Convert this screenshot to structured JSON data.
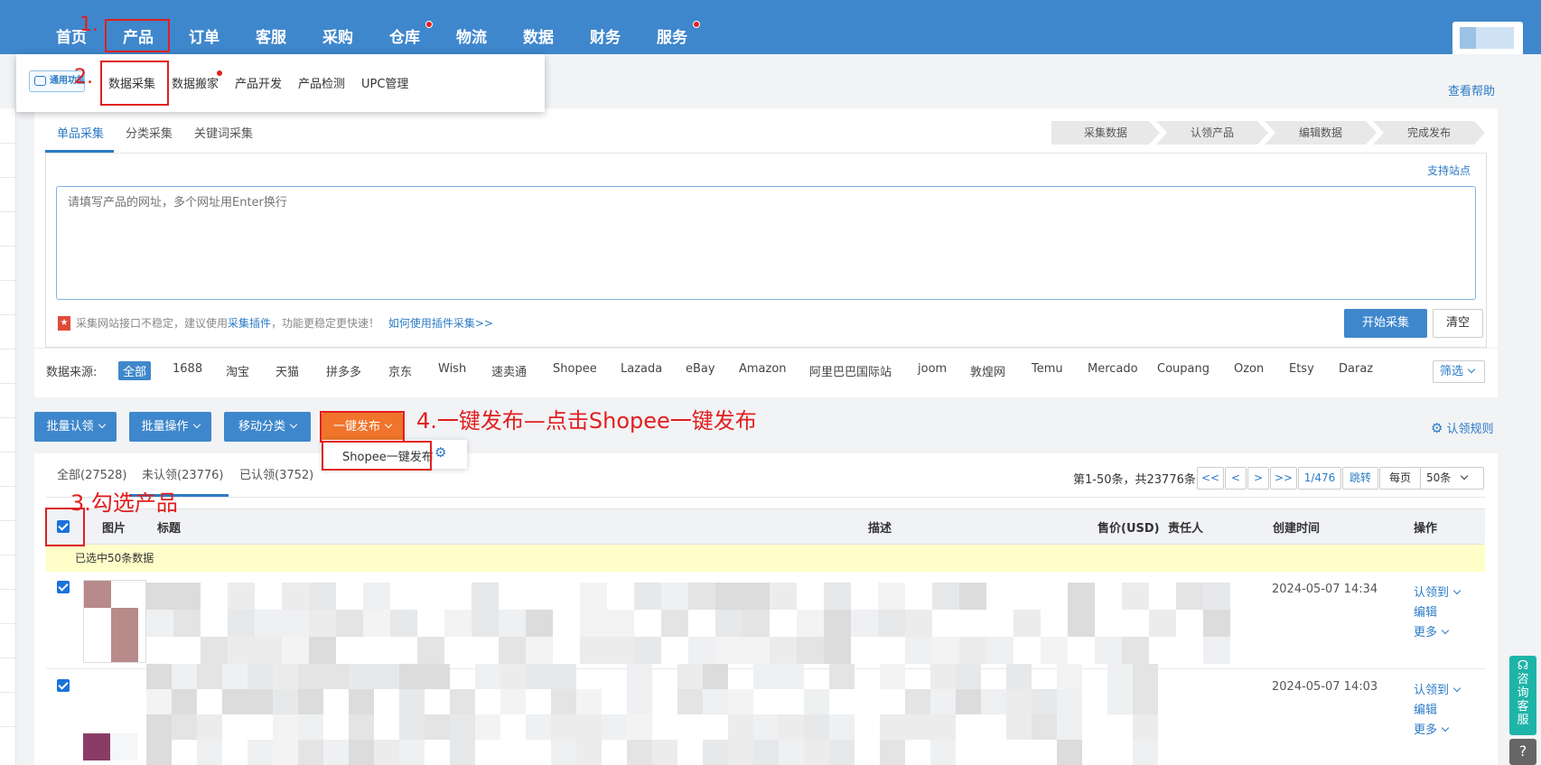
{
  "top_nav": {
    "items": [
      "首页",
      "产品",
      "订单",
      "客服",
      "采购",
      "仓库",
      "物流",
      "数据",
      "财务",
      "服务"
    ]
  },
  "sub_menu": {
    "badge": "通用功能",
    "items": [
      "数据采集",
      "数据搬家",
      "产品开发",
      "产品检测",
      "UPC管理"
    ]
  },
  "help_link": "查看帮助",
  "collect_tabs": [
    "单品采集",
    "分类采集",
    "关键词采集"
  ],
  "steps": [
    "采集数据",
    "认领产品",
    "编辑数据",
    "完成发布"
  ],
  "support_sites": "支持站点",
  "url_input": {
    "placeholder": "请填写产品的网址，多个网址用Enter换行"
  },
  "notice": {
    "text1": "采集网站接口不稳定，建议使用",
    "plugin_link": "采集插件",
    "text2": "，功能更稳定更快速！",
    "howto_link": "如何使用插件采集>>"
  },
  "start_button": "开始采集",
  "clear_button": "清空",
  "source": {
    "label": "数据来源:",
    "items": [
      "全部",
      "1688",
      "淘宝",
      "天猫",
      "拼多多",
      "京东",
      "Wish",
      "速卖通",
      "Shopee",
      "Lazada",
      "eBay",
      "Amazon",
      "阿里巴巴国际站",
      "joom",
      "敦煌网",
      "Temu",
      "Mercado",
      "Coupang",
      "Ozon",
      "Etsy",
      "Daraz"
    ],
    "filter": "筛选"
  },
  "actions": {
    "batch_claim": "批量认领",
    "batch_ops": "批量操作",
    "move_category": "移动分类",
    "one_click_publish": "一键发布",
    "shopee_publish": "Shopee一键发布",
    "claim_rules": "认领规则"
  },
  "product_tabs": [
    "全部(27528)",
    "未认领(23776)",
    "已认领(3752)"
  ],
  "pagination": {
    "info": "第1-50条，共23776条",
    "first": "<<",
    "prev": "<",
    "next": ">",
    "last": ">>",
    "page": "1/476",
    "jump": "跳转",
    "per_page_label": "每页",
    "per_page": "50条"
  },
  "table": {
    "headers": [
      "图片",
      "标题",
      "描述",
      "售价(USD)",
      "责任人",
      "创建时间",
      "操作"
    ],
    "selected_info": "已选中50条数据",
    "rows": [
      {
        "time": "2024-05-07 14:34",
        "op_claim": "认领到",
        "op_edit": "编辑",
        "op_more": "更多"
      },
      {
        "time": "2024-05-07 14:03",
        "op_claim": "认领到",
        "op_edit": "编辑",
        "op_more": "更多"
      }
    ]
  },
  "annotations": {
    "a1": "1.",
    "a2": "2.",
    "a3": "3.勾选产品",
    "a4": "4.一键发布—点击Shopee一键发布"
  },
  "service_widget": "咨询客服",
  "help_widget": "?",
  "colors": {
    "nav_blue": "#3f87cc",
    "link_blue": "#2c7bc6",
    "annotation_red": "#e02020",
    "publish_orange": "#f0742b",
    "service_teal": "#1fb4a8"
  }
}
